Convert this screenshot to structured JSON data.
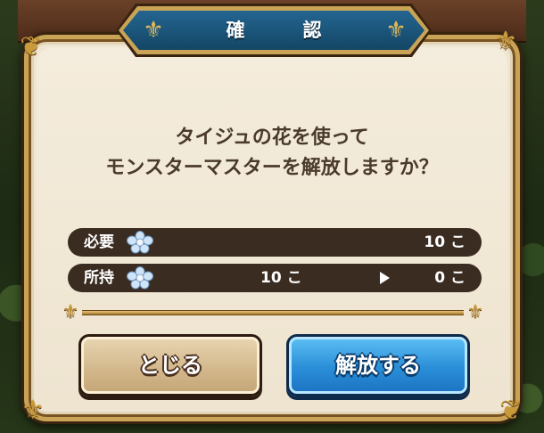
{
  "dialog": {
    "title": "確　認",
    "message_line1": "タイジュの花を使って",
    "message_line2": "モンスターマスターを解放しますか？"
  },
  "rows": [
    {
      "label": "必要",
      "icon": "flower-icon",
      "value": "10 こ"
    },
    {
      "label": "所持",
      "icon": "flower-icon",
      "from": "10 こ",
      "to": "0 こ"
    }
  ],
  "buttons": {
    "close_label": "とじる",
    "release_label": "解放する"
  },
  "colors": {
    "title_blue": "#1f5a80",
    "frame_gold": "#c9a456",
    "pill_dark": "#3b2c22",
    "button_blue": "#2a8ed8",
    "button_tan": "#d2b68a"
  }
}
